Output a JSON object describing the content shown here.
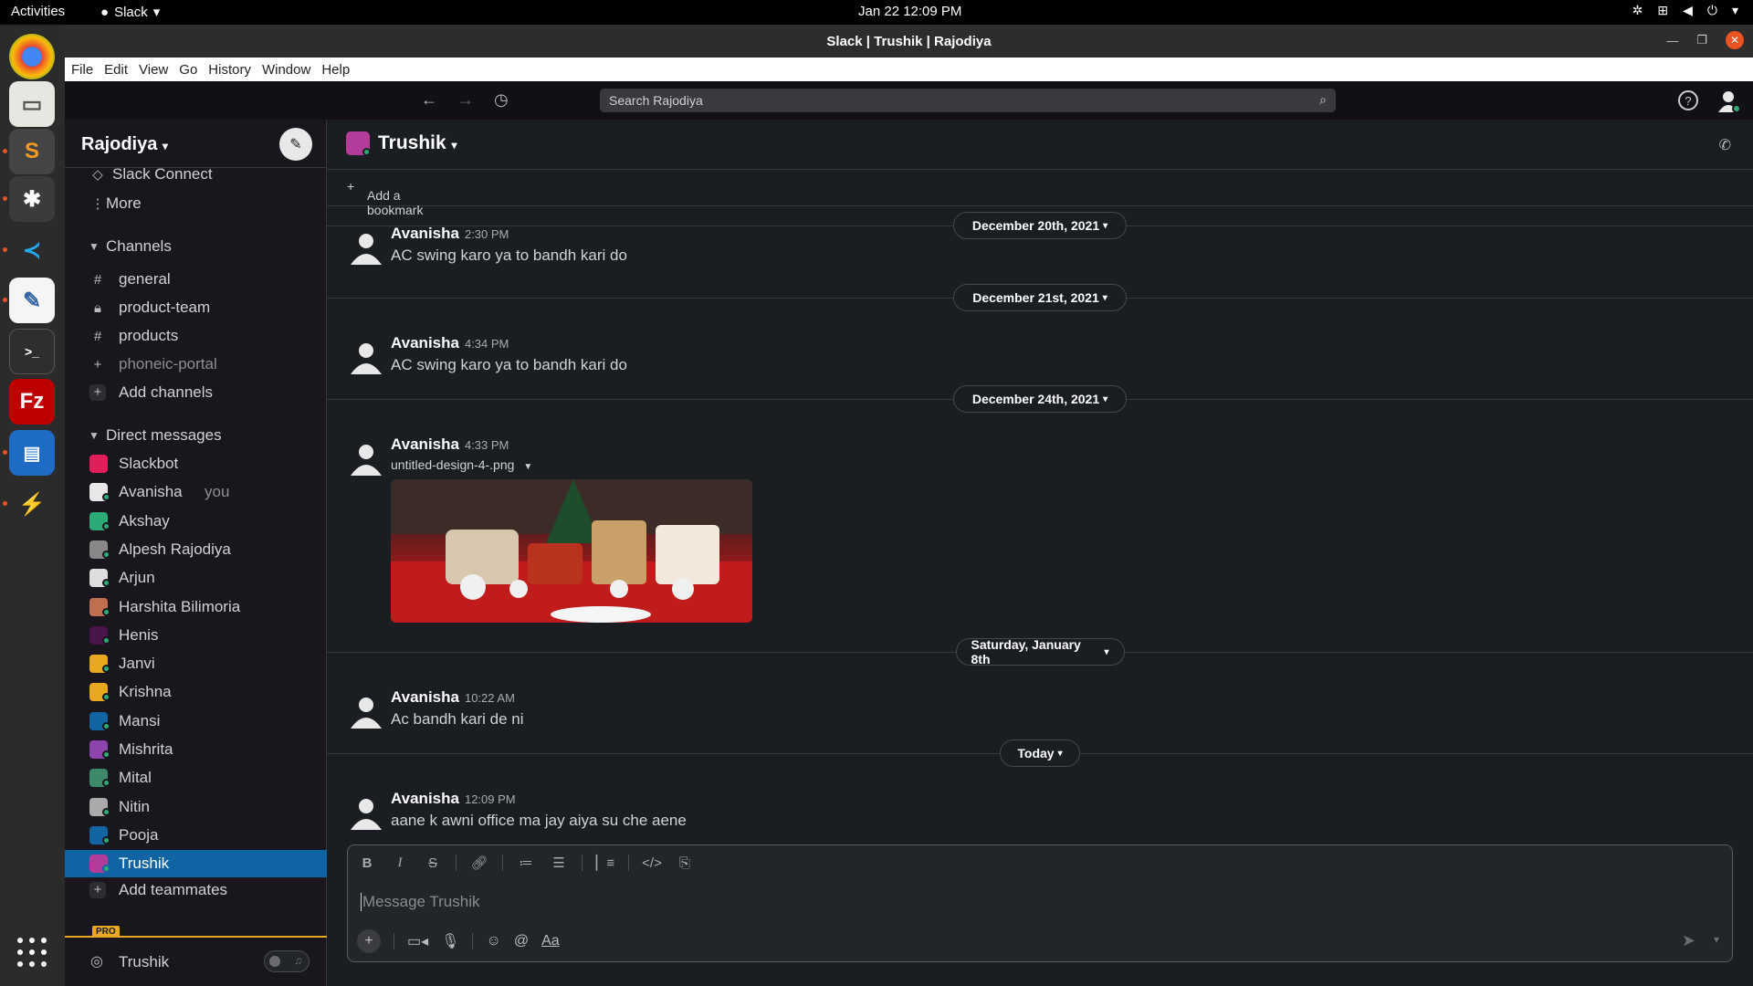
{
  "gnome": {
    "activities": "Activities",
    "app_menu": "Slack",
    "clock": "Jan 22  12:09 PM"
  },
  "window": {
    "title": "Slack | Trushik | Rajodiya"
  },
  "menubar": [
    "File",
    "Edit",
    "View",
    "Go",
    "History",
    "Window",
    "Help"
  ],
  "search": {
    "placeholder": "Search Rajodiya"
  },
  "workspace": {
    "name": "Rajodiya"
  },
  "sidebar": {
    "top_items": [
      {
        "label": "Slack Connect",
        "icon": "slack-connect-icon"
      },
      {
        "label": "More",
        "icon": "more-vertical-icon"
      }
    ],
    "channels_header": "Channels",
    "channels": [
      {
        "label": "general",
        "icon": "#"
      },
      {
        "label": "product-team",
        "icon": "lock"
      },
      {
        "label": "products",
        "icon": "#"
      },
      {
        "label": "phoneic-portal",
        "icon": "+"
      }
    ],
    "add_channels": "Add channels",
    "dm_header": "Direct messages",
    "dms": [
      {
        "label": "Slackbot",
        "color": "#e01e5a"
      },
      {
        "label": "Avanisha",
        "suffix": "you",
        "color": "#e8e8e8"
      },
      {
        "label": "Akshay",
        "color": "#2bac76"
      },
      {
        "label": "Alpesh Rajodiya",
        "color": "#888888"
      },
      {
        "label": "Arjun",
        "color": "#dddddd"
      },
      {
        "label": "Harshita Bilimoria",
        "color": "#c07050"
      },
      {
        "label": "Henis",
        "color": "#4a154b"
      },
      {
        "label": "Janvi",
        "color": "#e8a820"
      },
      {
        "label": "Krishna",
        "color": "#e8a820"
      },
      {
        "label": "Mansi",
        "color": "#1264a3"
      },
      {
        "label": "Mishrita",
        "color": "#8e44ad"
      },
      {
        "label": "Mital",
        "color": "#3d8a6b"
      },
      {
        "label": "Nitin",
        "color": "#aaaaaa"
      },
      {
        "label": "Pooja",
        "color": "#1264a3"
      },
      {
        "label": "Trushik",
        "color": "#b33b9a"
      }
    ],
    "add_teammates": "Add teammates",
    "pro_badge": "PRO",
    "footer_name": "Trushik"
  },
  "channel": {
    "title": "Trushik",
    "add_bookmark": "Add a bookmark",
    "composer_placeholder": "Message Trushik"
  },
  "messages": [
    {
      "date": "December 20th, 2021",
      "author": "Avanisha",
      "time": "2:30 PM",
      "text": "AC swing karo ya to bandh kari do"
    },
    {
      "date": "December 21st, 2021",
      "author": "Avanisha",
      "time": "4:34 PM",
      "text": "AC swing karo ya to bandh kari do"
    },
    {
      "date": "December 24th, 2021",
      "author": "Avanisha",
      "time": "4:33 PM",
      "file": "untitled-design-4-.png"
    },
    {
      "date": "Saturday, January 8th",
      "author": "Avanisha",
      "time": "10:22 AM",
      "text": "Ac bandh kari de ni"
    },
    {
      "date": "Today",
      "author": "Avanisha",
      "time": "12:09 PM",
      "text": "aane k awni office ma jay aiya  su che aene"
    }
  ],
  "colors": {
    "accent_active": "#1164a3",
    "online": "#2bac76",
    "pro": "#e8a820"
  }
}
